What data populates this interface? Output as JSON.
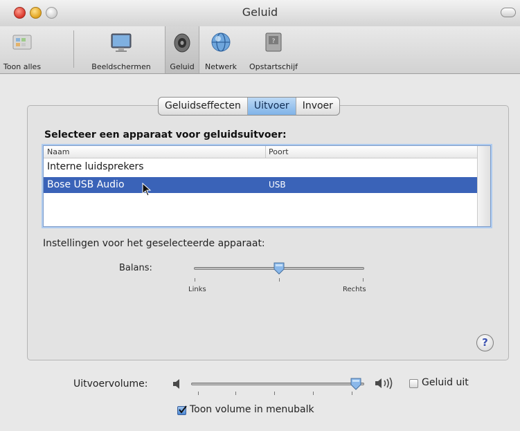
{
  "window": {
    "title": "Geluid"
  },
  "toolbar": {
    "items": [
      {
        "label": "Toon alles",
        "icon": "show-all-icon"
      },
      {
        "label": "Beeldschermen",
        "icon": "display-icon"
      },
      {
        "label": "Geluid",
        "icon": "speaker-icon",
        "selected": true
      },
      {
        "label": "Netwerk",
        "icon": "network-globe-icon"
      },
      {
        "label": "Opstartschijf",
        "icon": "startup-disk-icon"
      }
    ]
  },
  "tabs": [
    {
      "label": "Geluidseffecten",
      "active": false
    },
    {
      "label": "Uitvoer",
      "active": true
    },
    {
      "label": "Invoer",
      "active": false
    }
  ],
  "output": {
    "heading": "Selecteer een apparaat voor geluidsuitvoer:",
    "columns": {
      "name": "Naam",
      "port": "Poort"
    },
    "devices": [
      {
        "name": "Interne luidsprekers",
        "port": "",
        "selected": false
      },
      {
        "name": "Bose USB Audio",
        "port": "USB",
        "selected": true
      }
    ],
    "settings_label": "Instellingen voor het geselecteerde apparaat:",
    "balance": {
      "label": "Balans:",
      "left": "Links",
      "right": "Rechts",
      "value": 0.5
    }
  },
  "volume": {
    "label": "Uitvoervolume:",
    "value": 0.95,
    "mute_label": "Geluid uit",
    "mute_checked": false,
    "menubar_label": "Toon volume in menubalk",
    "menubar_checked": true
  },
  "help": {
    "label": "?"
  },
  "colors": {
    "selection": "#3a63b8",
    "active_tab": "#7fb3e8"
  }
}
